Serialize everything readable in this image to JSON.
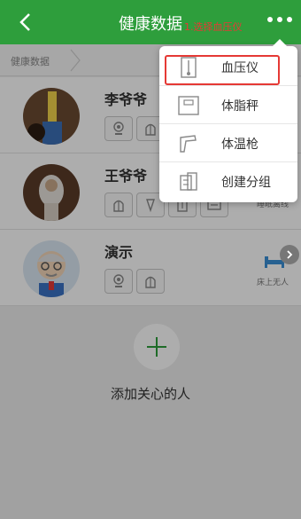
{
  "header": {
    "title": "健康数据",
    "annotation": "1.选择血压仪"
  },
  "breadcrumb": {
    "label": "健康数据"
  },
  "people": [
    {
      "name": "李爷爷",
      "status": ""
    },
    {
      "name": "王爷爷",
      "status": "睡眠离线"
    },
    {
      "name": "演示",
      "status": "床上无人"
    }
  ],
  "menu": {
    "items": [
      {
        "label": "血压仪",
        "icon": "blood-pressure-meter-icon"
      },
      {
        "label": "体脂秤",
        "icon": "body-fat-scale-icon"
      },
      {
        "label": "体温枪",
        "icon": "thermometer-gun-icon"
      },
      {
        "label": "创建分组",
        "icon": "create-group-icon"
      }
    ]
  },
  "add": {
    "label": "添加关心的人"
  },
  "colors": {
    "header": "#2e9e3c",
    "annotation": "#e53935",
    "highlight": "#e53935"
  }
}
